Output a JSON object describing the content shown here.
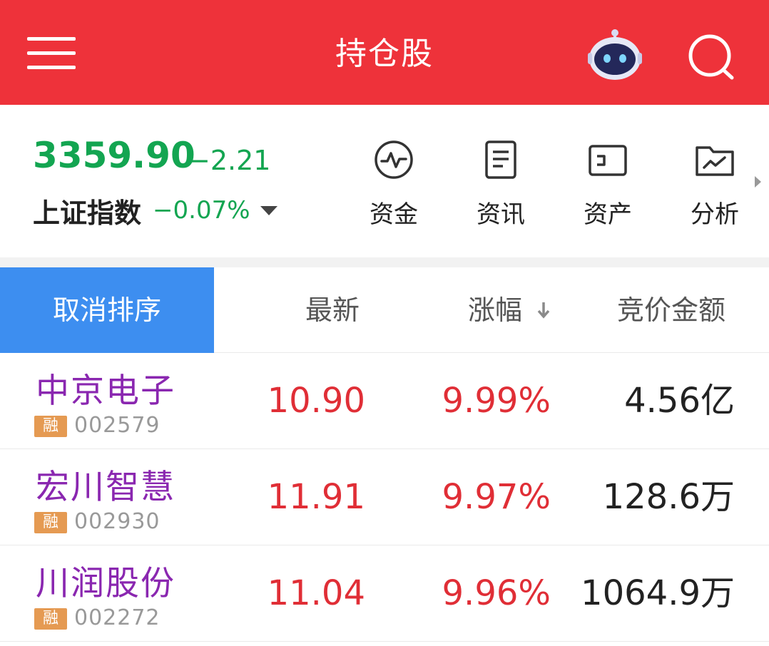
{
  "header": {
    "title": "持仓股",
    "menu_icon": "hamburger-icon",
    "assistant_icon": "robot-icon",
    "search_icon": "search-icon",
    "background_color": "#ee323a"
  },
  "index": {
    "value": "3359.90",
    "change": "−2.21",
    "name": "上证指数",
    "change_pct": "−0.07%",
    "color": "#13a551"
  },
  "quick_links": [
    {
      "label": "资金",
      "icon": "fund-flow-icon"
    },
    {
      "label": "资讯",
      "icon": "news-icon"
    },
    {
      "label": "资产",
      "icon": "asset-icon"
    },
    {
      "label": "分析",
      "icon": "analysis-icon"
    }
  ],
  "table": {
    "cancel_sort_label": "取消排序",
    "columns": {
      "latest": "最新",
      "change": "涨幅",
      "amount": "竞价金额"
    },
    "sort_accent": "#3d8ef0",
    "rows": [
      {
        "name": "中京电子",
        "tag": "融",
        "code": "002579",
        "latest": "10.90",
        "change": "9.99%",
        "amount": "4.56亿"
      },
      {
        "name": "宏川智慧",
        "tag": "融",
        "code": "002930",
        "latest": "11.91",
        "change": "9.97%",
        "amount": "128.6万"
      },
      {
        "name": "川润股份",
        "tag": "融",
        "code": "002272",
        "latest": "11.04",
        "change": "9.96%",
        "amount": "1064.9万"
      }
    ]
  }
}
